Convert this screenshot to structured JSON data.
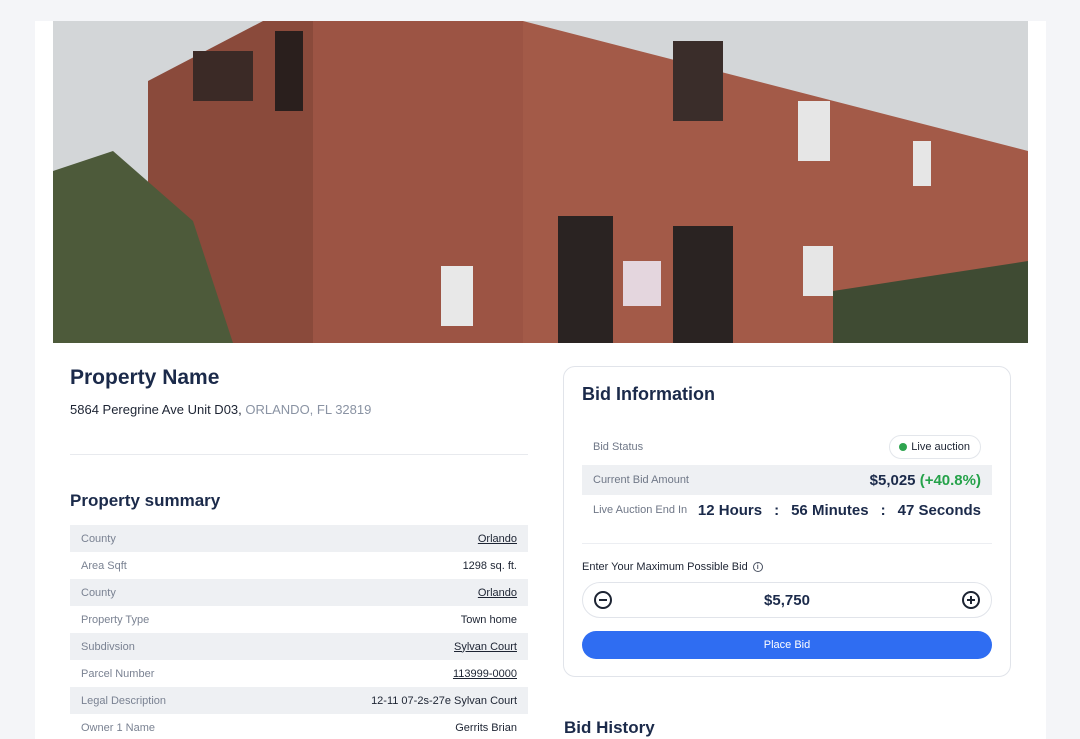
{
  "property": {
    "title": "Property Name",
    "street": "5864 Peregrine Ave Unit D03,",
    "city": "ORLANDO, FL 32819"
  },
  "summary": {
    "title": "Property summary",
    "rows": [
      {
        "label": "County",
        "value": "Orlando"
      },
      {
        "label": "Area Sqft",
        "value": "1298 sq. ft."
      },
      {
        "label": "County",
        "value": "Orlando"
      },
      {
        "label": "Property Type",
        "value": "Town home"
      },
      {
        "label": "Subdivsion",
        "value": "Sylvan Court"
      },
      {
        "label": "Parcel Number",
        "value": "113999-0000"
      },
      {
        "label": "Legal Description",
        "value": "12-11 07-2s-27e Sylvan Court"
      },
      {
        "label": "Owner 1 Name",
        "value": "Gerrits Brian"
      }
    ]
  },
  "bid": {
    "title": "Bid Information",
    "status_label": "Bid Status",
    "status_value": "Live auction",
    "current_label": "Current Bid Amount",
    "current_amount": "$5,025",
    "current_change": "(+40.8%)",
    "end_label": "Live Auction End In",
    "countdown": {
      "hours": "12 Hours",
      "minutes": "56 Minutes",
      "seconds": "47 Seconds",
      "sep": ":"
    },
    "max_label": "Enter Your Maximum Possible Bid",
    "max_value": "$5,750",
    "place_label": "Place Bid",
    "icons": {
      "decrement": "minus-circle-icon",
      "increment": "plus-circle-icon",
      "info": "info-icon"
    }
  },
  "history": {
    "title": "Bid History"
  },
  "colors": {
    "accent": "#2f6df2",
    "positive": "#25a24a",
    "live": "#2ea44f",
    "heading": "#1b2a4a"
  }
}
